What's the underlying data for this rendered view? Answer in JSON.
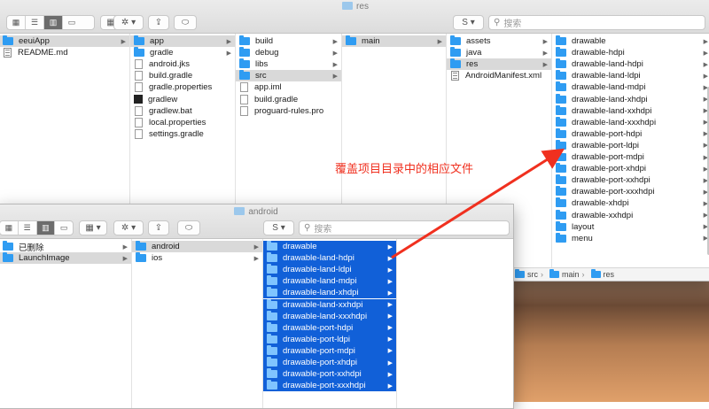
{
  "colors": {
    "accent": "#1160d8",
    "folder": "#2f9cf2",
    "annotation": "#f0301f"
  },
  "back_window": {
    "title": "res",
    "search_placeholder": "搜索",
    "columns": [
      {
        "items": [
          {
            "label": "eeuiApp",
            "icon": "folder",
            "selected": true
          },
          {
            "label": "README.md",
            "icon": "doc"
          }
        ]
      },
      {
        "items": [
          {
            "label": "app",
            "icon": "folder",
            "selected": true
          },
          {
            "label": "gradle",
            "icon": "folder"
          },
          {
            "label": "android.jks",
            "icon": "file"
          },
          {
            "label": "build.gradle",
            "icon": "file"
          },
          {
            "label": "gradle.properties",
            "icon": "file"
          },
          {
            "label": "gradlew",
            "icon": "exe"
          },
          {
            "label": "gradlew.bat",
            "icon": "file"
          },
          {
            "label": "local.properties",
            "icon": "file"
          },
          {
            "label": "settings.gradle",
            "icon": "file"
          }
        ]
      },
      {
        "items": [
          {
            "label": "build",
            "icon": "folder"
          },
          {
            "label": "debug",
            "icon": "folder"
          },
          {
            "label": "libs",
            "icon": "folder"
          },
          {
            "label": "src",
            "icon": "folder",
            "selected": true
          },
          {
            "label": "app.iml",
            "icon": "file"
          },
          {
            "label": "build.gradle",
            "icon": "file"
          },
          {
            "label": "proguard-rules.pro",
            "icon": "file"
          }
        ]
      },
      {
        "items": [
          {
            "label": "main",
            "icon": "folder",
            "selected": true
          }
        ]
      },
      {
        "items": [
          {
            "label": "assets",
            "icon": "folder"
          },
          {
            "label": "java",
            "icon": "folder"
          },
          {
            "label": "res",
            "icon": "folder",
            "selected": true
          },
          {
            "label": "AndroidManifest.xml",
            "icon": "doc"
          }
        ]
      },
      {
        "items": [
          {
            "label": "drawable",
            "icon": "folder"
          },
          {
            "label": "drawable-hdpi",
            "icon": "folder"
          },
          {
            "label": "drawable-land-hdpi",
            "icon": "folder"
          },
          {
            "label": "drawable-land-ldpi",
            "icon": "folder"
          },
          {
            "label": "drawable-land-mdpi",
            "icon": "folder"
          },
          {
            "label": "drawable-land-xhdpi",
            "icon": "folder"
          },
          {
            "label": "drawable-land-xxhdpi",
            "icon": "folder"
          },
          {
            "label": "drawable-land-xxxhdpi",
            "icon": "folder"
          },
          {
            "label": "drawable-port-hdpi",
            "icon": "folder"
          },
          {
            "label": "drawable-port-ldpi",
            "icon": "folder"
          },
          {
            "label": "drawable-port-mdpi",
            "icon": "folder"
          },
          {
            "label": "drawable-port-xhdpi",
            "icon": "folder"
          },
          {
            "label": "drawable-port-xxhdpi",
            "icon": "folder"
          },
          {
            "label": "drawable-port-xxxhdpi",
            "icon": "folder"
          },
          {
            "label": "drawable-xhdpi",
            "icon": "folder"
          },
          {
            "label": "drawable-xxhdpi",
            "icon": "folder"
          },
          {
            "label": "layout",
            "icon": "folder"
          },
          {
            "label": "menu",
            "icon": "folder"
          }
        ]
      }
    ],
    "path": [
      "src",
      "main",
      "res"
    ]
  },
  "front_window": {
    "title": "android",
    "search_placeholder": "搜索",
    "columns": [
      {
        "items": [
          {
            "label": "已删除",
            "icon": "folder"
          },
          {
            "label": "LaunchImage",
            "icon": "folder",
            "selected": true
          }
        ]
      },
      {
        "items": [
          {
            "label": "android",
            "icon": "folder",
            "selected": true
          },
          {
            "label": "ios",
            "icon": "folder"
          }
        ]
      },
      {
        "items": [
          {
            "label": "drawable",
            "icon": "folder"
          },
          {
            "label": "drawable-land-hdpi",
            "icon": "folder"
          },
          {
            "label": "drawable-land-ldpi",
            "icon": "folder"
          },
          {
            "label": "drawable-land-mdpi",
            "icon": "folder"
          },
          {
            "label": "drawable-land-xhdpi",
            "icon": "folder"
          },
          {
            "label": "drawable-land-xxhdpi",
            "icon": "folder"
          },
          {
            "label": "drawable-land-xxxhdpi",
            "icon": "folder"
          },
          {
            "label": "drawable-port-hdpi",
            "icon": "folder"
          },
          {
            "label": "drawable-port-ldpi",
            "icon": "folder"
          },
          {
            "label": "drawable-port-mdpi",
            "icon": "folder"
          },
          {
            "label": "drawable-port-xhdpi",
            "icon": "folder"
          },
          {
            "label": "drawable-port-xxhdpi",
            "icon": "folder"
          },
          {
            "label": "drawable-port-xxxhdpi",
            "icon": "folder"
          }
        ]
      }
    ]
  },
  "annotation": "覆盖项目目录中的相应文件"
}
